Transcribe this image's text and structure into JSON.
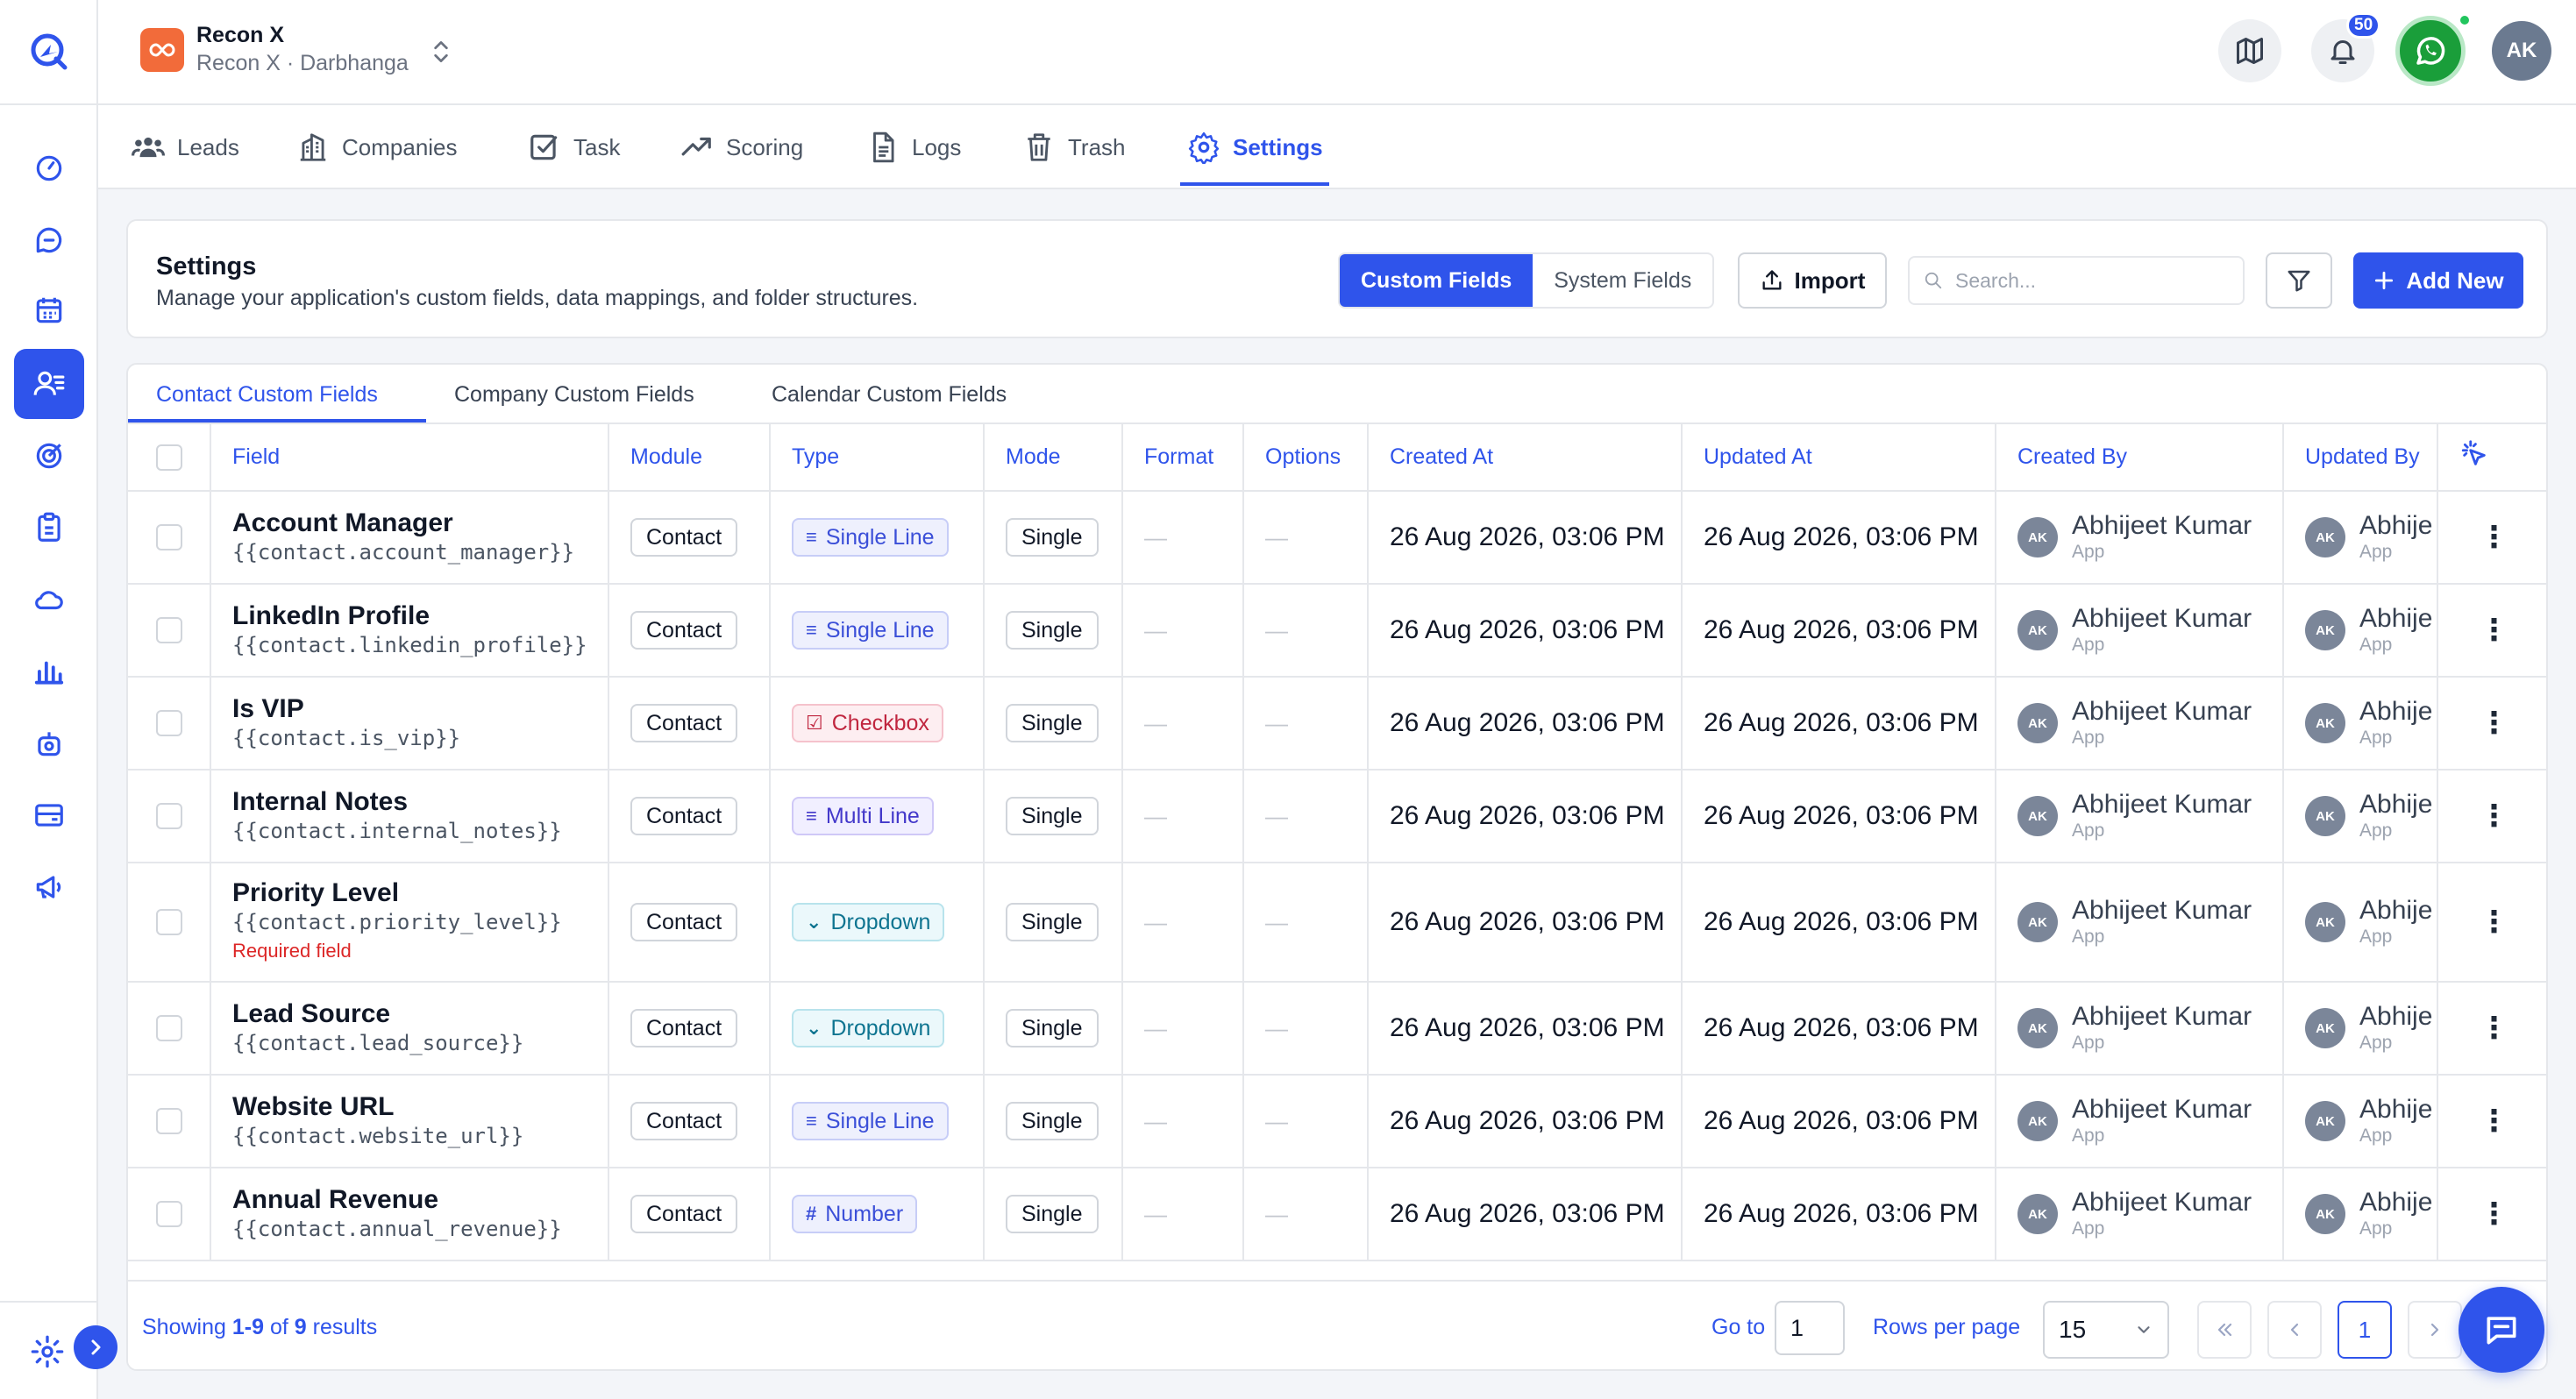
{
  "header": {
    "org_name": "Recon X",
    "org_sub": "Recon X · Darbhanga",
    "notification_count": "50",
    "user_initials": "AK"
  },
  "modules": [
    {
      "label": "Leads",
      "icon": "users-icon"
    },
    {
      "label": "Companies",
      "icon": "building-icon"
    },
    {
      "label": "Task",
      "icon": "checkbox-icon"
    },
    {
      "label": "Scoring",
      "icon": "trend-icon"
    },
    {
      "label": "Logs",
      "icon": "document-icon"
    },
    {
      "label": "Trash",
      "icon": "trash-icon"
    },
    {
      "label": "Settings",
      "icon": "gear-icon"
    }
  ],
  "settings_card": {
    "title": "Settings",
    "description": "Manage your application's custom fields, data mappings, and folder structures.",
    "seg_custom": "Custom Fields",
    "seg_system": "System Fields",
    "import_label": "Import",
    "search_placeholder": "Search...",
    "add_label": "Add New"
  },
  "subtabs": [
    "Contact Custom Fields",
    "Company Custom Fields",
    "Calendar Custom Fields"
  ],
  "columns": [
    "Field",
    "Module",
    "Type",
    "Mode",
    "Format",
    "Options",
    "Created At",
    "Updated At",
    "Created By",
    "Updated By"
  ],
  "rows": [
    {
      "name": "Account Manager",
      "key": "{{contact.account_manager}}",
      "module": "Contact",
      "type": "Single Line",
      "type_style": "line",
      "mode": "Single",
      "format": "—",
      "options": "—",
      "created_at": "26 Aug 2026, 03:06 PM",
      "updated_at": "26 Aug 2026, 03:06 PM",
      "created_by": "Abhijeet Kumar",
      "created_via": "App",
      "updated_by": "Abhije",
      "updated_via": "App",
      "av": "AK"
    },
    {
      "name": "LinkedIn Profile",
      "key": "{{contact.linkedin_profile}}",
      "module": "Contact",
      "type": "Single Line",
      "type_style": "line",
      "mode": "Single",
      "format": "—",
      "options": "—",
      "created_at": "26 Aug 2026, 03:06 PM",
      "updated_at": "26 Aug 2026, 03:06 PM",
      "created_by": "Abhijeet Kumar",
      "created_via": "App",
      "updated_by": "Abhije",
      "updated_via": "App",
      "av": "AK"
    },
    {
      "name": "Is VIP",
      "key": "{{contact.is_vip}}",
      "module": "Contact",
      "type": "Checkbox",
      "type_style": "checkbox",
      "mode": "Single",
      "format": "—",
      "options": "—",
      "created_at": "26 Aug 2026, 03:06 PM",
      "updated_at": "26 Aug 2026, 03:06 PM",
      "created_by": "Abhijeet Kumar",
      "created_via": "App",
      "updated_by": "Abhije",
      "updated_via": "App",
      "av": "AK"
    },
    {
      "name": "Internal Notes",
      "key": "{{contact.internal_notes}}",
      "module": "Contact",
      "type": "Multi Line",
      "type_style": "multi",
      "mode": "Single",
      "format": "—",
      "options": "—",
      "created_at": "26 Aug 2026, 03:06 PM",
      "updated_at": "26 Aug 2026, 03:06 PM",
      "created_by": "Abhijeet Kumar",
      "created_via": "App",
      "updated_by": "Abhije",
      "updated_via": "App",
      "av": "AK"
    },
    {
      "name": "Priority Level",
      "key": "{{contact.priority_level}}",
      "required": "Required field",
      "module": "Contact",
      "type": "Dropdown",
      "type_style": "dropdown",
      "mode": "Single",
      "format": "—",
      "options": "—",
      "created_at": "26 Aug 2026, 03:06 PM",
      "updated_at": "26 Aug 2026, 03:06 PM",
      "created_by": "Abhijeet Kumar",
      "created_via": "App",
      "updated_by": "Abhije",
      "updated_via": "App",
      "av": "AK"
    },
    {
      "name": "Lead Source",
      "key": "{{contact.lead_source}}",
      "module": "Contact",
      "type": "Dropdown",
      "type_style": "dropdown",
      "mode": "Single",
      "format": "—",
      "options": "—",
      "created_at": "26 Aug 2026, 03:06 PM",
      "updated_at": "26 Aug 2026, 03:06 PM",
      "created_by": "Abhijeet Kumar",
      "created_via": "App",
      "updated_by": "Abhije",
      "updated_via": "App",
      "av": "AK"
    },
    {
      "name": "Website URL",
      "key": "{{contact.website_url}}",
      "module": "Contact",
      "type": "Single Line",
      "type_style": "line",
      "mode": "Single",
      "format": "—",
      "options": "—",
      "created_at": "26 Aug 2026, 03:06 PM",
      "updated_at": "26 Aug 2026, 03:06 PM",
      "created_by": "Abhijeet Kumar",
      "created_via": "App",
      "updated_by": "Abhije",
      "updated_via": "App",
      "av": "AK"
    },
    {
      "name": "Annual Revenue",
      "key": "{{contact.annual_revenue}}",
      "module": "Contact",
      "type": "Number",
      "type_style": "number",
      "mode": "Single",
      "format": "—",
      "options": "—",
      "created_at": "26 Aug 2026, 03:06 PM",
      "updated_at": "26 Aug 2026, 03:06 PM",
      "created_by": "Abhijeet Kumar",
      "created_via": "App",
      "updated_by": "Abhije",
      "updated_via": "App",
      "av": "AK"
    }
  ],
  "pagination": {
    "showing_prefix": "Showing",
    "range": "1-9",
    "of": "of",
    "total": "9",
    "suffix": "results",
    "goto_label": "Go to",
    "goto_value": "1",
    "rows_label": "Rows per page",
    "rows_value": "15",
    "current_page": "1"
  },
  "colors": {
    "accent": "#2f54eb",
    "org_logo": "#f26b3a",
    "whatsapp": "#1a9e3a",
    "required": "#dc2626"
  }
}
